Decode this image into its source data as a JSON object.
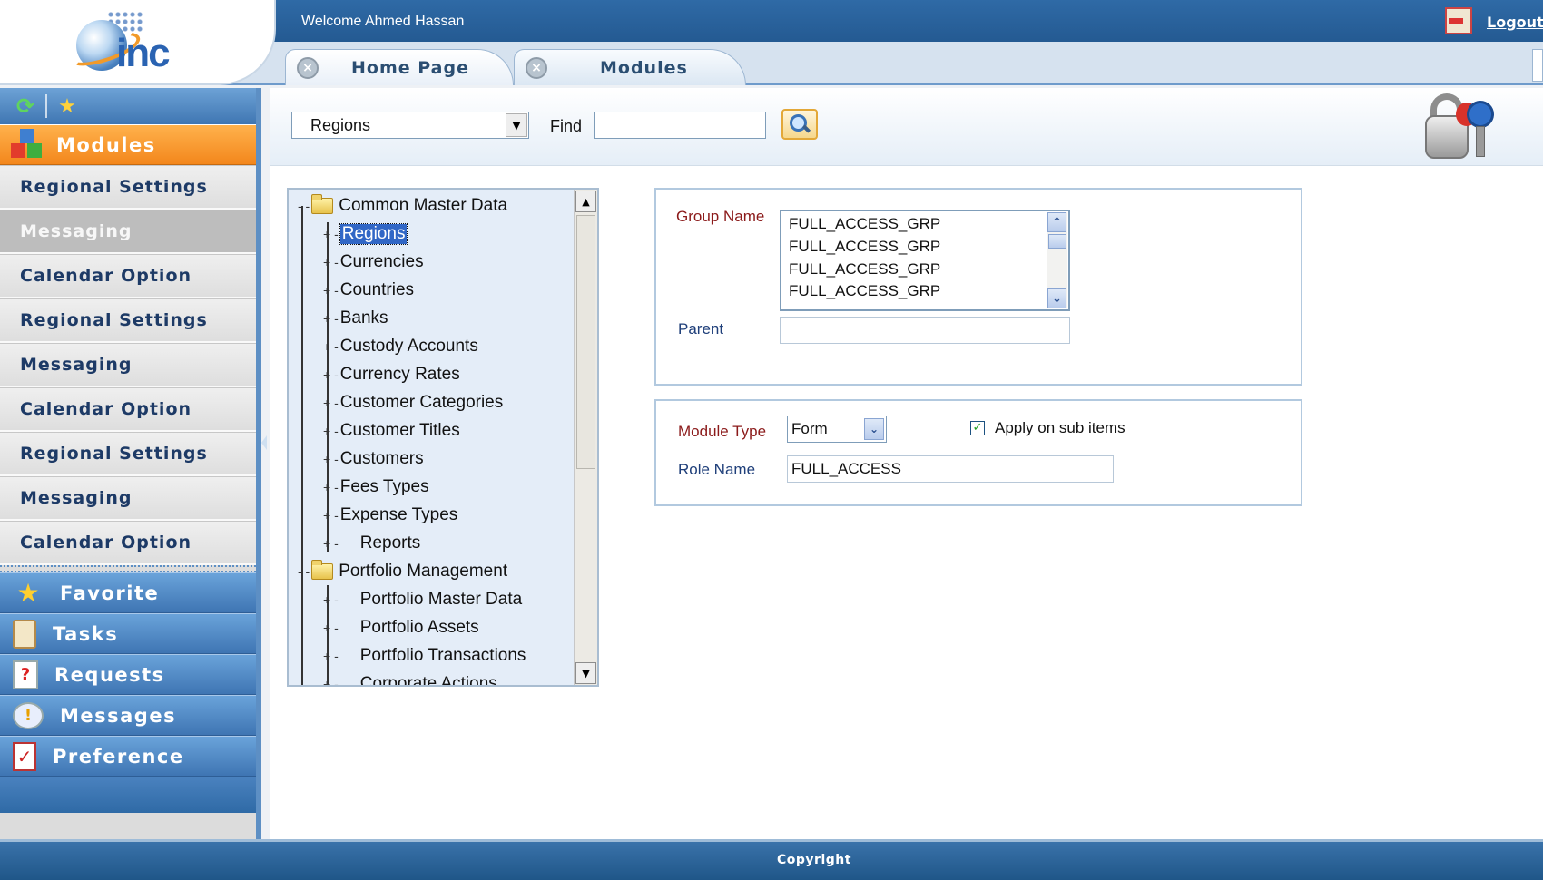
{
  "header": {
    "logo_text": "inc",
    "welcome": "Welcome Ahmed Hassan",
    "logout": "Logout",
    "tabs": [
      {
        "label": "Home Page",
        "close": "×"
      },
      {
        "label": "Modules",
        "close": "×"
      }
    ]
  },
  "sidebar": {
    "modules_label": "Modules",
    "items": [
      {
        "label": "Regional Settings"
      },
      {
        "label": "Messaging",
        "active": true
      },
      {
        "label": "Calendar Option"
      },
      {
        "label": "Regional Settings"
      },
      {
        "label": "Messaging"
      },
      {
        "label": "Calendar Option"
      },
      {
        "label": "Regional Settings"
      },
      {
        "label": "Messaging"
      },
      {
        "label": "Calendar Option"
      }
    ],
    "sections": [
      {
        "label": "Favorite",
        "icon": "star-icon"
      },
      {
        "label": "Tasks",
        "icon": "clipboard-icon"
      },
      {
        "label": "Requests",
        "icon": "question-document-icon"
      },
      {
        "label": "Messages",
        "icon": "warning-chat-icon"
      },
      {
        "label": "Preference",
        "icon": "checklist-icon"
      }
    ]
  },
  "filter": {
    "selected": "Regions",
    "find_label": "Find",
    "find_value": ""
  },
  "tree": {
    "nodes": [
      {
        "label": "Common Master Data",
        "prefix": "- -",
        "folder": true
      },
      {
        "label": "Regions",
        "prefix": "+ -",
        "selected": true
      },
      {
        "label": "Currencies",
        "prefix": "+ -"
      },
      {
        "label": "Countries",
        "prefix": "+ -"
      },
      {
        "label": "Banks",
        "prefix": "+ -"
      },
      {
        "label": "Custody Accounts",
        "prefix": "+ -"
      },
      {
        "label": "Currency Rates",
        "prefix": "+ -"
      },
      {
        "label": "Customer Categories",
        "prefix": "+ -"
      },
      {
        "label": "Customer Titles",
        "prefix": "+ -"
      },
      {
        "label": "Customers",
        "prefix": "+ -"
      },
      {
        "label": "Fees Types",
        "prefix": "+ -"
      },
      {
        "label": "Expense Types",
        "prefix": "+ -"
      },
      {
        "label": "Reports",
        "prefix": "+ -"
      },
      {
        "label": "Portfolio Management",
        "prefix": "- -",
        "folder": true
      },
      {
        "label": "Portfolio Master Data",
        "prefix": "+ -"
      },
      {
        "label": "Portfolio Assets",
        "prefix": "+ -"
      },
      {
        "label": "Portfolio Transactions",
        "prefix": "+ -"
      },
      {
        "label": "Corporate Actions",
        "prefix": "+ -"
      }
    ]
  },
  "group_form": {
    "group_name_label": "Group Name",
    "groups": [
      "FULL_ACCESS_GRP",
      "FULL_ACCESS_GRP",
      "FULL_ACCESS_GRP",
      "FULL_ACCESS_GRP"
    ],
    "parent_label": "Parent",
    "parent_value": ""
  },
  "module_form": {
    "module_type_label": "Module Type",
    "module_type_value": "Form",
    "apply_label": "Apply on sub items",
    "apply_checked": true,
    "role_name_label": "Role Name",
    "role_name_value": "FULL_ACCESS"
  },
  "footer": {
    "copyright": "Copyright"
  }
}
